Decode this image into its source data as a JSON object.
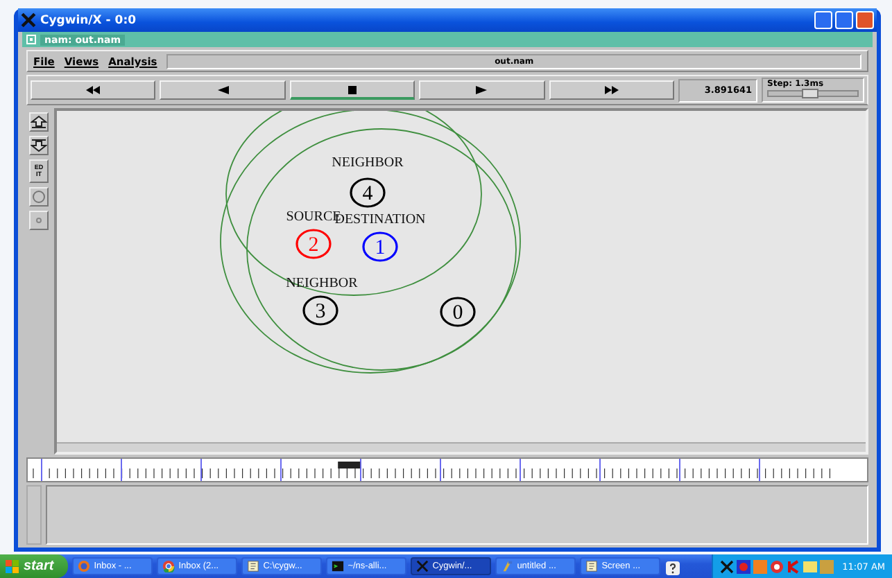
{
  "window": {
    "title": "Cygwin/X - 0:0"
  },
  "app": {
    "title": "nam: out.nam"
  },
  "menu": [
    {
      "label": "File"
    },
    {
      "label": "Views"
    },
    {
      "label": "Analysis"
    }
  ],
  "file_name": "out.nam",
  "controls": [
    {
      "kind": "rewind",
      "selected": false
    },
    {
      "kind": "back",
      "selected": false
    },
    {
      "kind": "stop",
      "selected": true
    },
    {
      "kind": "play",
      "selected": false
    },
    {
      "kind": "forward",
      "selected": false
    }
  ],
  "time": "3.891641",
  "step": {
    "label": "Step: 1.3ms",
    "level": 0.45
  },
  "tools": [
    {
      "kind": "zoom-in"
    },
    {
      "kind": "zoom-out"
    },
    {
      "kind": "text",
      "label": "ED IT"
    },
    {
      "kind": "circle"
    },
    {
      "kind": "dot"
    }
  ],
  "nodes": [
    {
      "id": "4",
      "label": "NEIGHBOR",
      "color": "#000000"
    },
    {
      "id": "2",
      "label": "SOURCE",
      "color": "#ff0000"
    },
    {
      "id": "1",
      "label": "DESTINATION",
      "color": "#0000ff"
    },
    {
      "id": "3",
      "label": "NEIGHBOR",
      "color": "#000000"
    },
    {
      "id": "0",
      "color": "#000000"
    }
  ],
  "timeline": {
    "level": 0.4
  },
  "taskbar": {
    "start": "start",
    "items": [
      {
        "label": "Inbox - ...",
        "kind": "fox",
        "selected": false
      },
      {
        "label": "Inbox (2...",
        "kind": "chrome",
        "selected": false
      },
      {
        "label": "C:\\cygw...",
        "kind": "note",
        "selected": false
      },
      {
        "label": "~/ns-alli...",
        "kind": "term",
        "selected": false
      },
      {
        "label": "Cygwin/...",
        "kind": "x",
        "selected": true
      },
      {
        "label": "untitled ...",
        "kind": "paint",
        "selected": false
      },
      {
        "label": "Screen ...",
        "kind": "note",
        "selected": false
      }
    ],
    "clock": "11:07 AM"
  }
}
